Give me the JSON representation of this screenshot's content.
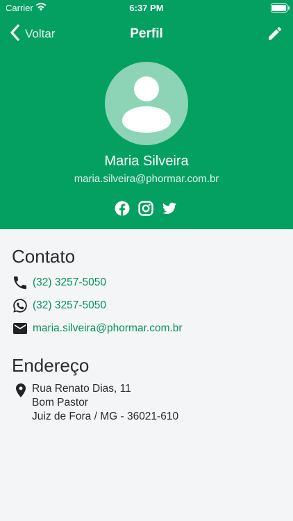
{
  "status_bar": {
    "carrier": "Carrier",
    "time": "6:37 PM"
  },
  "nav": {
    "back_label": "Voltar",
    "title": "Perfil"
  },
  "profile": {
    "name": "Maria Silveira",
    "email": "maria.silveira@phormar.com.br"
  },
  "social": [
    "facebook-icon",
    "instagram-icon",
    "twitter-icon"
  ],
  "contact": {
    "title": "Contato",
    "phone": "(32) 3257-5050",
    "whatsapp": "(32) 3257-5050",
    "email": "maria.silveira@phormar.com.br"
  },
  "address": {
    "title": "Endereço",
    "line1": "Rua Renato Dias, 11",
    "line2": "Bom Pastor",
    "line3": "Juiz de Fora / MG - 36021-610"
  },
  "colors": {
    "brand": "#04a062",
    "link": "#05925b",
    "background": "#f4f5f7"
  }
}
